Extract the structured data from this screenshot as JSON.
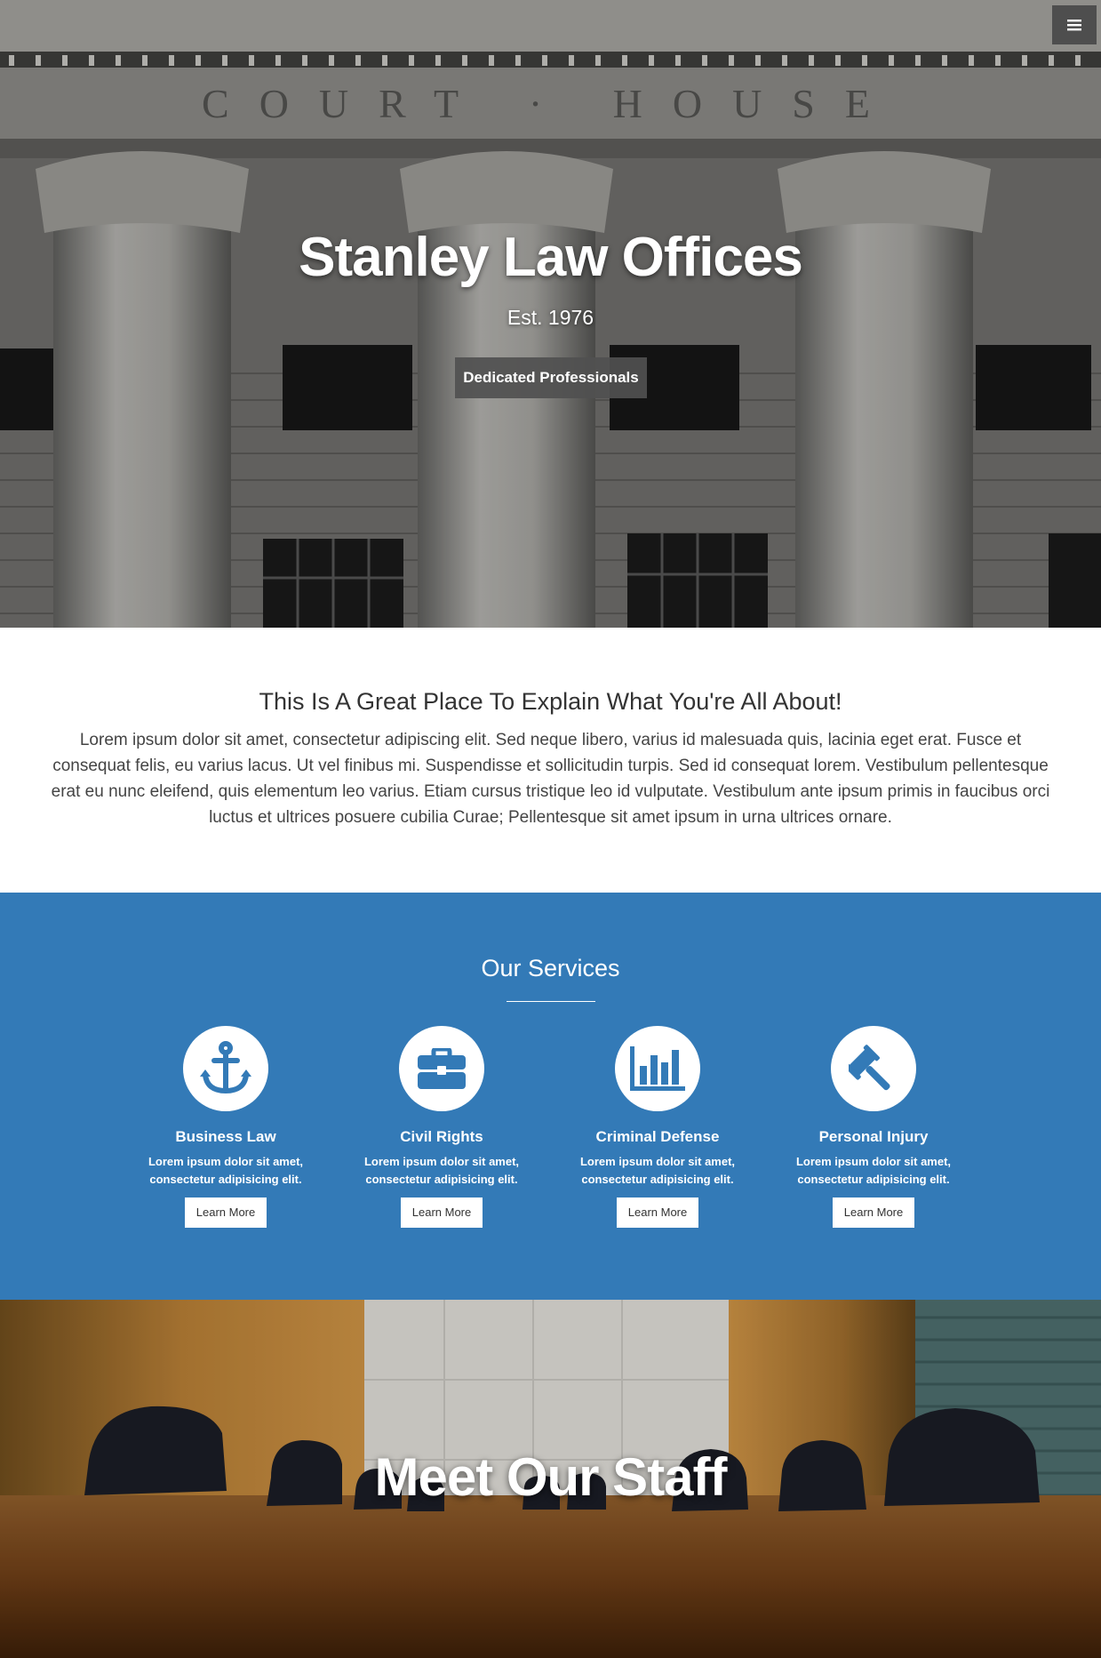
{
  "hero": {
    "title": "Stanley Law Offices",
    "subtitle": "Est. 1976",
    "button_label": "Dedicated Professionals",
    "engraving": "COURT · HOUSE"
  },
  "menu": {
    "icon": "hamburger-menu-icon"
  },
  "about": {
    "heading": "This Is A Great Place To Explain What You're All About!",
    "body": "Lorem ipsum dolor sit amet, consectetur adipiscing elit. Sed neque libero, varius id malesuada quis, lacinia eget erat. Fusce et consequat felis, eu varius lacus. Ut vel finibus mi. Suspendisse et sollicitudin turpis. Sed id consequat lorem. Vestibulum pellentesque erat eu nunc eleifend, quis elementum leo varius. Etiam cursus tristique leo id vulputate. Vestibulum ante ipsum primis in faucibus orci luctus et ultrices posuere cubilia Curae; Pellentesque sit amet ipsum in urna ultrices ornare."
  },
  "services": {
    "heading": "Our Services",
    "items": [
      {
        "name": "Business Law",
        "desc": "Lorem ipsum dolor sit amet, consectetur adipisicing elit.",
        "button": "Learn More",
        "icon": "anchor-icon"
      },
      {
        "name": "Civil Rights",
        "desc": "Lorem ipsum dolor sit amet, consectetur adipisicing elit.",
        "button": "Learn More",
        "icon": "briefcase-icon"
      },
      {
        "name": "Criminal Defense",
        "desc": "Lorem ipsum dolor sit amet, consectetur adipisicing elit.",
        "button": "Learn More",
        "icon": "bar-chart-icon"
      },
      {
        "name": "Personal Injury",
        "desc": "Lorem ipsum dolor sit amet, consectetur adipisicing elit.",
        "button": "Learn More",
        "icon": "gavel-icon"
      }
    ]
  },
  "staff": {
    "heading": "Meet Our Staff"
  },
  "colors": {
    "primary": "#337ab7",
    "white": "#ffffff",
    "text": "#333333",
    "hero_button": "#505050"
  }
}
